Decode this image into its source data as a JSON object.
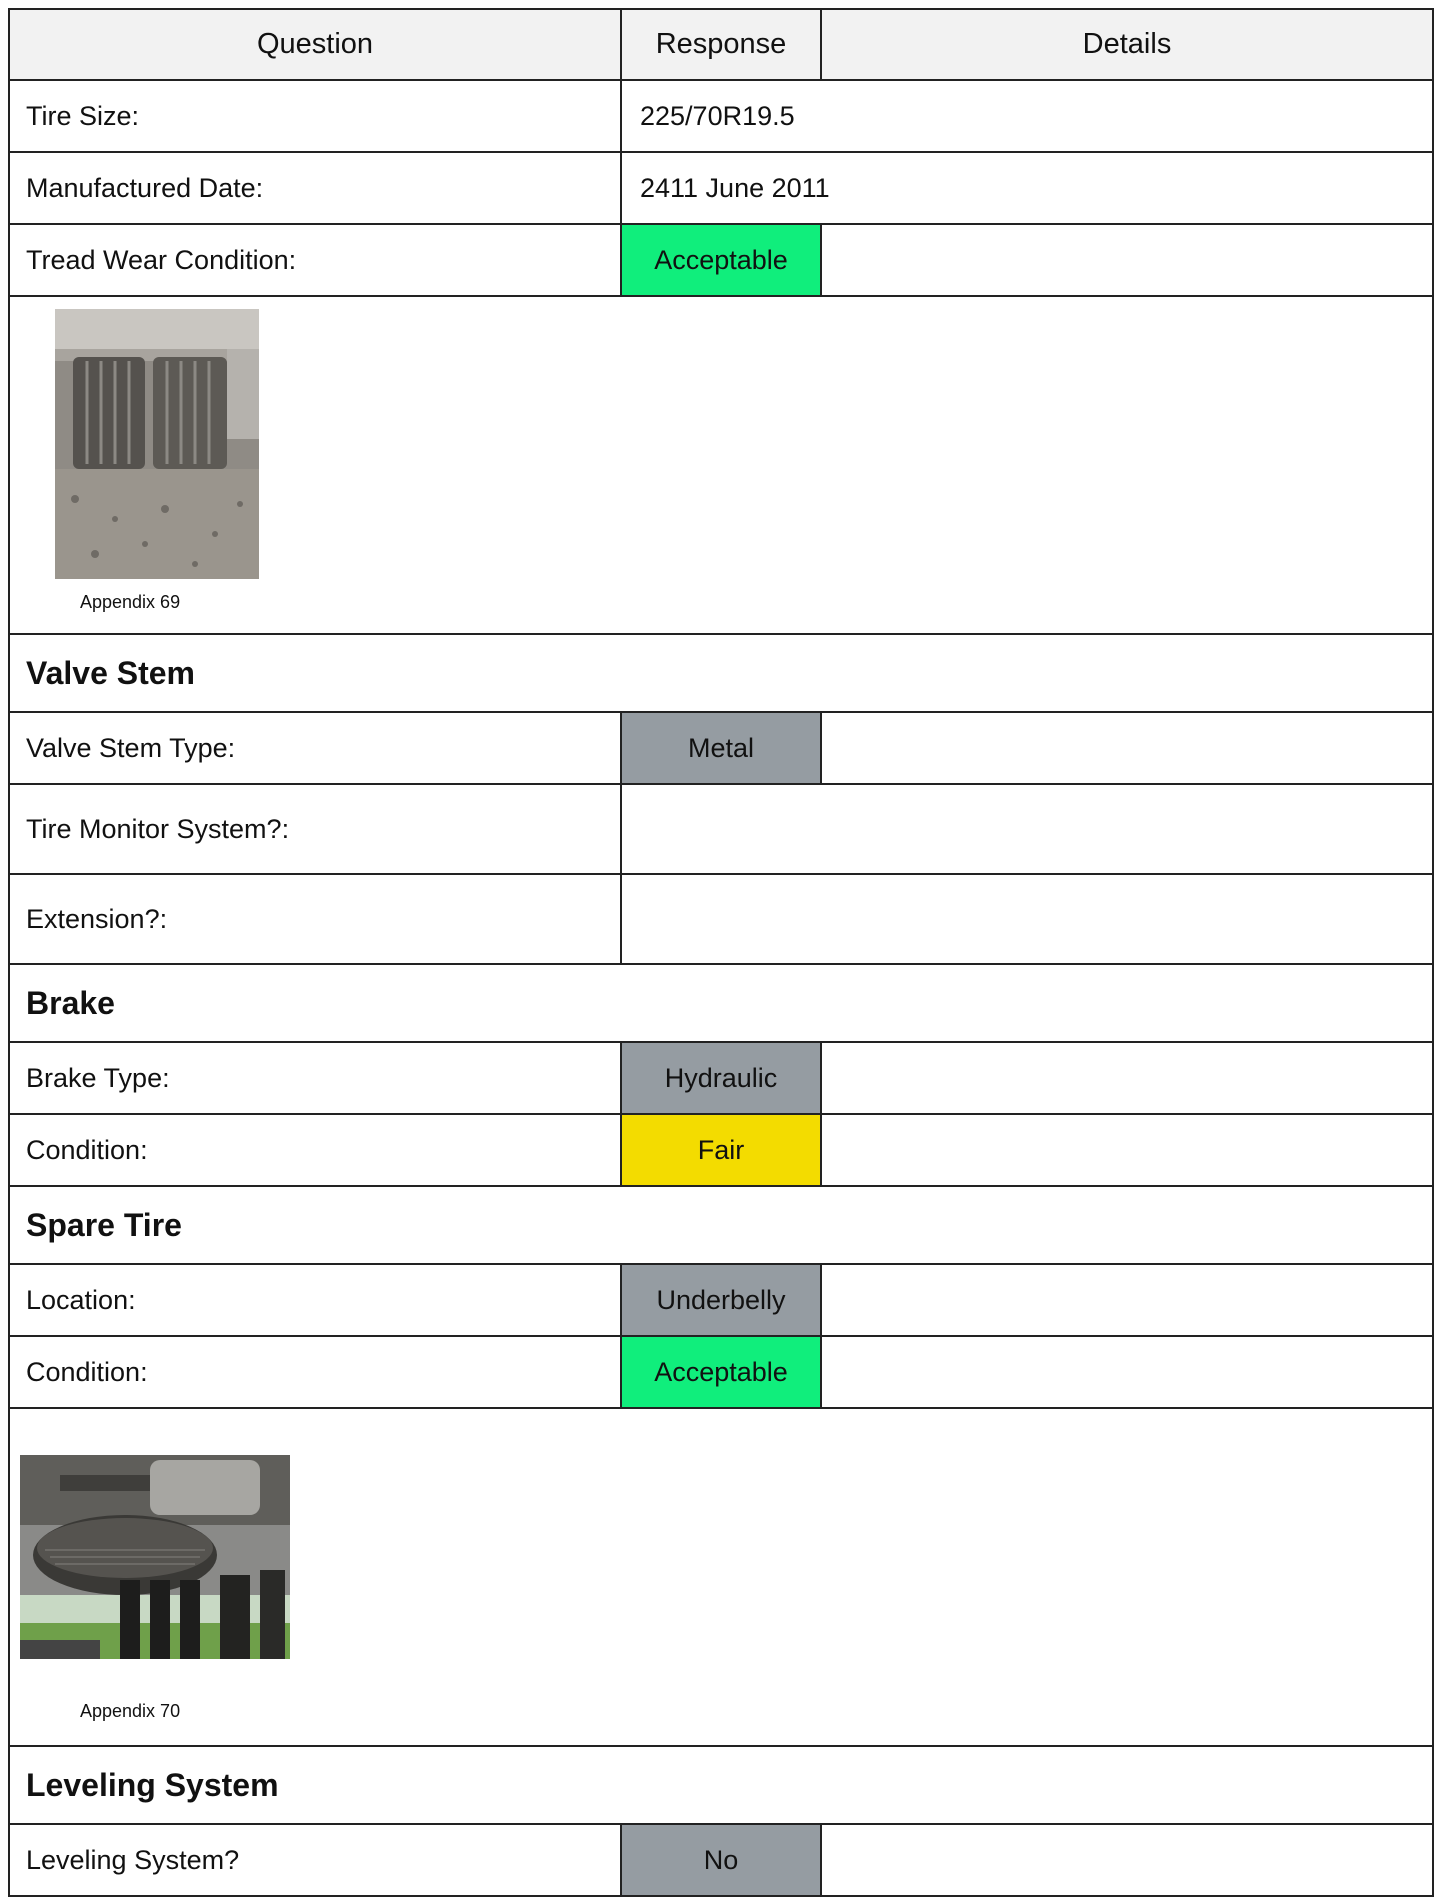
{
  "header": {
    "question": "Question",
    "response": "Response",
    "details": "Details"
  },
  "tire": {
    "size_label": "Tire Size:",
    "size_value": "225/70R19.5",
    "date_label": "Manufactured Date:",
    "date_value": "2411 June 2011",
    "tread_label": "Tread Wear Condition:",
    "tread_value": "Acceptable",
    "photo_caption": "Appendix 69"
  },
  "valve_stem": {
    "title": "Valve Stem",
    "type_label": "Valve Stem Type:",
    "type_value": "Metal",
    "monitor_label": "Tire Monitor System?:",
    "extension_label": "Extension?:"
  },
  "brake": {
    "title": "Brake",
    "type_label": "Brake Type:",
    "type_value": "Hydraulic",
    "condition_label": "Condition:",
    "condition_value": "Fair"
  },
  "spare_tire": {
    "title": "Spare Tire",
    "location_label": "Location:",
    "location_value": "Underbelly",
    "condition_label": "Condition:",
    "condition_value": "Acceptable",
    "photo_caption": "Appendix 70"
  },
  "leveling": {
    "title": "Leveling System",
    "system_label": "Leveling System?",
    "system_value": "No"
  },
  "colors": {
    "acceptable": "#10ee7c",
    "neutral": "#959ca2",
    "fair": "#f3dc00"
  }
}
